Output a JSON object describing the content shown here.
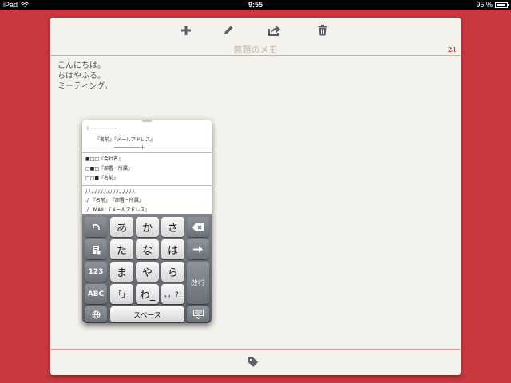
{
  "status_bar": {
    "carrier": "iPad",
    "time": "9:55",
    "battery": "95 %",
    "battery_level": 0.95
  },
  "toolbar": {
    "add_icon": "plus-icon",
    "edit_icon": "pencil-icon",
    "share_icon": "share-icon",
    "delete_icon": "trash-icon"
  },
  "note": {
    "title": "無題のメモ",
    "char_count": "21",
    "lines": [
      "こんにちは。",
      "ちはやふる。",
      "ミーティング。"
    ]
  },
  "template_popover": {
    "items": [
      "＋─────────",
      "『名前』『メールアドレス』",
      "─────────＋",
      "■□□『会社名』",
      "□■□『部署・所属』",
      "□□■『名前』",
      "/./././././././././././././././.",
      "./　『名前』　『部署・所属』",
      "./　MAIL:『メールアドレス』"
    ]
  },
  "keyboard": {
    "row1": [
      "あ",
      "か",
      "さ"
    ],
    "row2": [
      "た",
      "な",
      "は"
    ],
    "row3": [
      "ま",
      "や",
      "ら"
    ],
    "row4": [
      "「」",
      "わ_",
      "、。?!"
    ],
    "num_label": "123",
    "abc_label": "ABC",
    "space_label": "スペース",
    "return_label": "改行",
    "key_icons": [
      "undo-icon",
      "paste-icon",
      "backspace-icon",
      "arrow-right-icon",
      "globe-icon",
      "keyboard-dismiss-icon"
    ]
  },
  "colors": {
    "background": "#c8383e",
    "paper": "#f4f2ec",
    "rule": "#e4a3a6",
    "accent": "#b43636"
  },
  "footer": {
    "tag_icon": "tag-icon"
  }
}
